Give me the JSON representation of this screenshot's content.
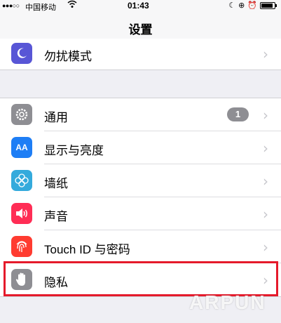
{
  "status_bar": {
    "signal": "●●●○○",
    "carrier": "中国移动",
    "time": "01:43",
    "battery_level": 0.9
  },
  "nav": {
    "title": "设置"
  },
  "rows": [
    {
      "label": "勿扰模式",
      "icon": "moon-icon",
      "color": "#5856d6"
    },
    {
      "label": "通用",
      "icon": "gear-icon",
      "color": "#8e8e93",
      "badge": "1"
    },
    {
      "label": "显示与亮度",
      "icon": "text-size-icon",
      "color": "#1e7ef5"
    },
    {
      "label": "墙纸",
      "icon": "flower-icon",
      "color": "#34aadc"
    },
    {
      "label": "声音",
      "icon": "speaker-icon",
      "color": "#ff2d55"
    },
    {
      "label": "Touch ID 与密码",
      "icon": "fingerprint-icon",
      "color": "#ff3b30"
    },
    {
      "label": "隐私",
      "icon": "hand-icon",
      "color": "#8e8e93"
    }
  ],
  "icon_text": {
    "display": "AA"
  },
  "watermark": "ARPUN",
  "colors": {
    "highlight": "#e51a2b",
    "chevron": "#c7c7cc"
  }
}
